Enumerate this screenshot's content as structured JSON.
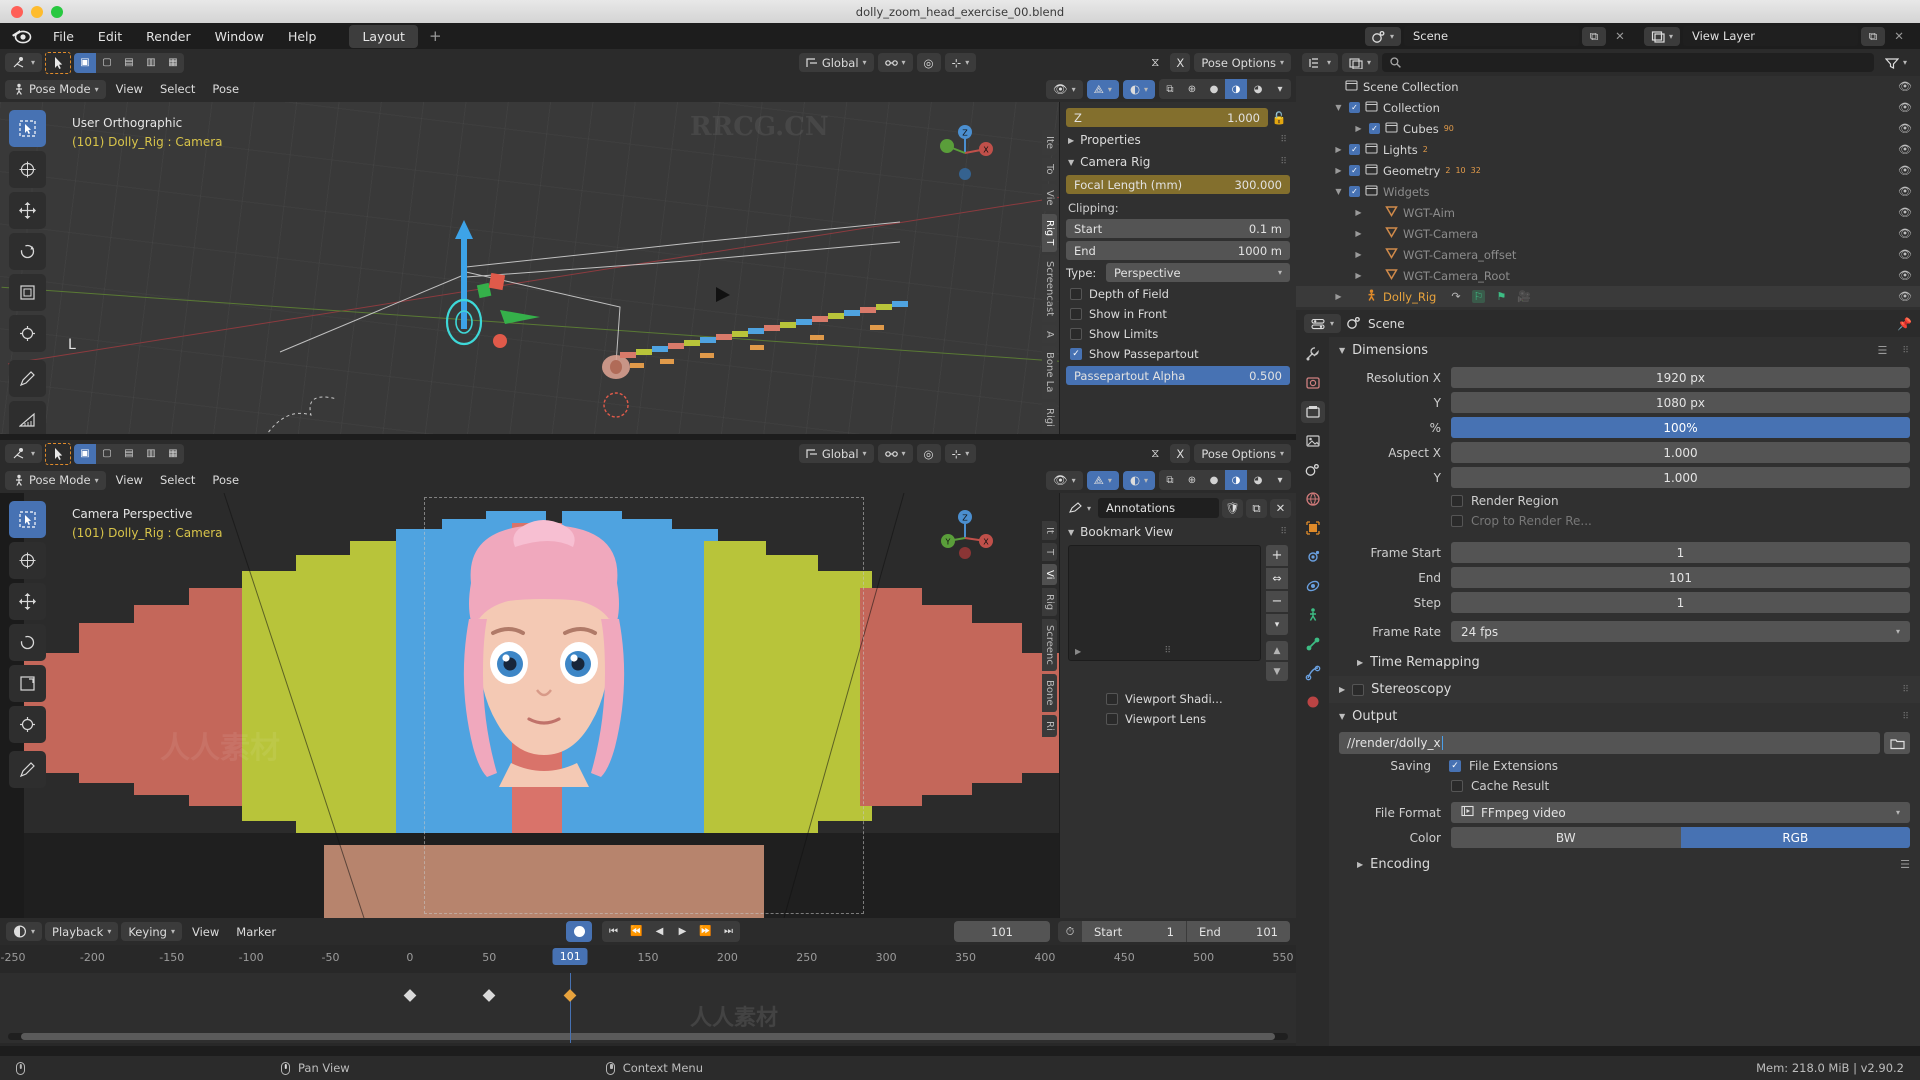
{
  "window": {
    "title": "dolly_zoom_head_exercise_00.blend"
  },
  "topbar": {
    "menus": [
      "File",
      "Edit",
      "Render",
      "Window",
      "Help"
    ],
    "workspace_tab": "Layout",
    "add_workspace": "+",
    "scene_label": "Scene",
    "viewlayer_label": "View Layer"
  },
  "viewport_tools": {
    "mode": "Pose Mode",
    "menus": [
      "View",
      "Select",
      "Pose"
    ],
    "transform_orientation": "Global",
    "pose_options": "Pose Options"
  },
  "viewport1": {
    "overlay_line1": "User Orthographic",
    "overlay_line2": "(101) Dolly_Rig : Camera"
  },
  "viewport2": {
    "overlay_line1": "Camera Perspective",
    "overlay_line2": "(101) Dolly_Rig : Camera"
  },
  "npanel1": {
    "z_label": "Z",
    "z_value": "1.000",
    "properties_header": "Properties",
    "camera_rig_header": "Camera Rig",
    "focal_label": "Focal Length (mm)",
    "focal_value": "300.000",
    "clipping_label": "Clipping:",
    "start_label": "Start",
    "start_value": "0.1 m",
    "end_label": "End",
    "end_value": "1000 m",
    "type_label": "Type:",
    "type_value": "Perspective",
    "checks": [
      {
        "label": "Depth of Field",
        "checked": false
      },
      {
        "label": "Show in Front",
        "checked": false
      },
      {
        "label": "Show Limits",
        "checked": false
      },
      {
        "label": "Show Passepartout",
        "checked": true
      }
    ],
    "passepartout_label": "Passepartout Alpha",
    "passepartout_value": "0.500",
    "tabs": [
      "Ite",
      "To",
      "Vie",
      "Rig T",
      "Screencast",
      "A",
      "Bone La",
      "Rigi"
    ]
  },
  "npanel2": {
    "annotations_label": "Annotations",
    "bookmark_header": "Bookmark View",
    "viewport_shading": "Viewport Shadi...",
    "viewport_lens": "Viewport Lens",
    "tabs": [
      "It",
      "T",
      "Vi",
      "Rig",
      "Screenc",
      "Bone",
      "Ri"
    ]
  },
  "outliner": {
    "search_placeholder": "",
    "rows": [
      {
        "label": "Scene Collection",
        "depth": 0,
        "kind": "collection",
        "disclosure": "",
        "checkbox": false,
        "dim": false,
        "selected": false,
        "counts": []
      },
      {
        "label": "Collection",
        "depth": 1,
        "kind": "collection",
        "disclosure": "▼",
        "checkbox": true,
        "dim": false,
        "selected": false,
        "counts": []
      },
      {
        "label": "Cubes",
        "depth": 2,
        "kind": "collection",
        "disclosure": "▶",
        "checkbox": true,
        "dim": false,
        "selected": false,
        "counts": [
          "90"
        ]
      },
      {
        "label": "Lights",
        "depth": 1,
        "kind": "collection",
        "disclosure": "▶",
        "checkbox": true,
        "dim": false,
        "selected": false,
        "counts": [
          "2"
        ]
      },
      {
        "label": "Geometry",
        "depth": 1,
        "kind": "collection",
        "disclosure": "▶",
        "checkbox": true,
        "dim": false,
        "selected": false,
        "counts": [
          "2",
          "10",
          "32"
        ]
      },
      {
        "label": "Widgets",
        "depth": 1,
        "kind": "collection",
        "disclosure": "▼",
        "checkbox": true,
        "dim": true,
        "selected": false,
        "counts": []
      },
      {
        "label": "WGT-Aim",
        "depth": 2,
        "kind": "mesh",
        "disclosure": "▶",
        "checkbox": false,
        "dim": true,
        "selected": false,
        "counts": []
      },
      {
        "label": "WGT-Camera",
        "depth": 2,
        "kind": "mesh",
        "disclosure": "▶",
        "checkbox": false,
        "dim": true,
        "selected": false,
        "counts": []
      },
      {
        "label": "WGT-Camera_offset",
        "depth": 2,
        "kind": "mesh",
        "disclosure": "▶",
        "checkbox": false,
        "dim": true,
        "selected": false,
        "counts": []
      },
      {
        "label": "WGT-Camera_Root",
        "depth": 2,
        "kind": "mesh",
        "disclosure": "▶",
        "checkbox": false,
        "dim": true,
        "selected": false,
        "counts": []
      },
      {
        "label": "Dolly_Rig",
        "depth": 1,
        "kind": "armature",
        "disclosure": "▶",
        "checkbox": false,
        "dim": false,
        "selected": true,
        "counts": []
      }
    ]
  },
  "properties": {
    "breadcrumb": "Scene",
    "dimensions_header": "Dimensions",
    "rows": [
      {
        "label": "Resolution X",
        "value": "1920 px",
        "style": "normal"
      },
      {
        "label": "Y",
        "value": "1080 px",
        "style": "normal"
      },
      {
        "label": "%",
        "value": "100%",
        "style": "blue"
      },
      {
        "label": "Aspect X",
        "value": "1.000",
        "style": "normal"
      },
      {
        "label": "Y",
        "value": "1.000",
        "style": "normal"
      }
    ],
    "render_region": "Render Region",
    "crop_to_render": "Crop to Render Re...",
    "frame_start_label": "Frame Start",
    "frame_start_value": "1",
    "frame_end_label": "End",
    "frame_end_value": "101",
    "frame_step_label": "Step",
    "frame_step_value": "1",
    "frame_rate_label": "Frame Rate",
    "frame_rate_value": "24 fps",
    "time_remapping": "Time Remapping",
    "stereoscopy": "Stereoscopy",
    "output_header": "Output",
    "output_path": "//render/dolly_x",
    "saving_label": "Saving",
    "file_extensions": "File Extensions",
    "cache_result": "Cache Result",
    "file_format_label": "File Format",
    "file_format_value": "FFmpeg video",
    "color_label": "Color",
    "color_bw": "BW",
    "color_rgb": "RGB",
    "encoding_header": "Encoding"
  },
  "timeline": {
    "editor_menus": [
      "Playback",
      "Keying",
      "View",
      "Marker"
    ],
    "current_frame": "101",
    "start_label": "Start",
    "start_value": "1",
    "end_label": "End",
    "end_value": "101",
    "ruler_ticks": [
      "-250",
      "-200",
      "-150",
      "-100",
      "-50",
      "0",
      "50",
      "101",
      "150",
      "200",
      "250",
      "300",
      "350",
      "400",
      "450",
      "500",
      "550"
    ],
    "keyframes": [
      0,
      50,
      101
    ]
  },
  "status": {
    "pan_view": "Pan View",
    "context_menu": "Context Menu",
    "memory": "Mem: 218.0 MiB | v2.90.2"
  },
  "watermarks": [
    "RRCG.CN",
    "人人素材"
  ]
}
